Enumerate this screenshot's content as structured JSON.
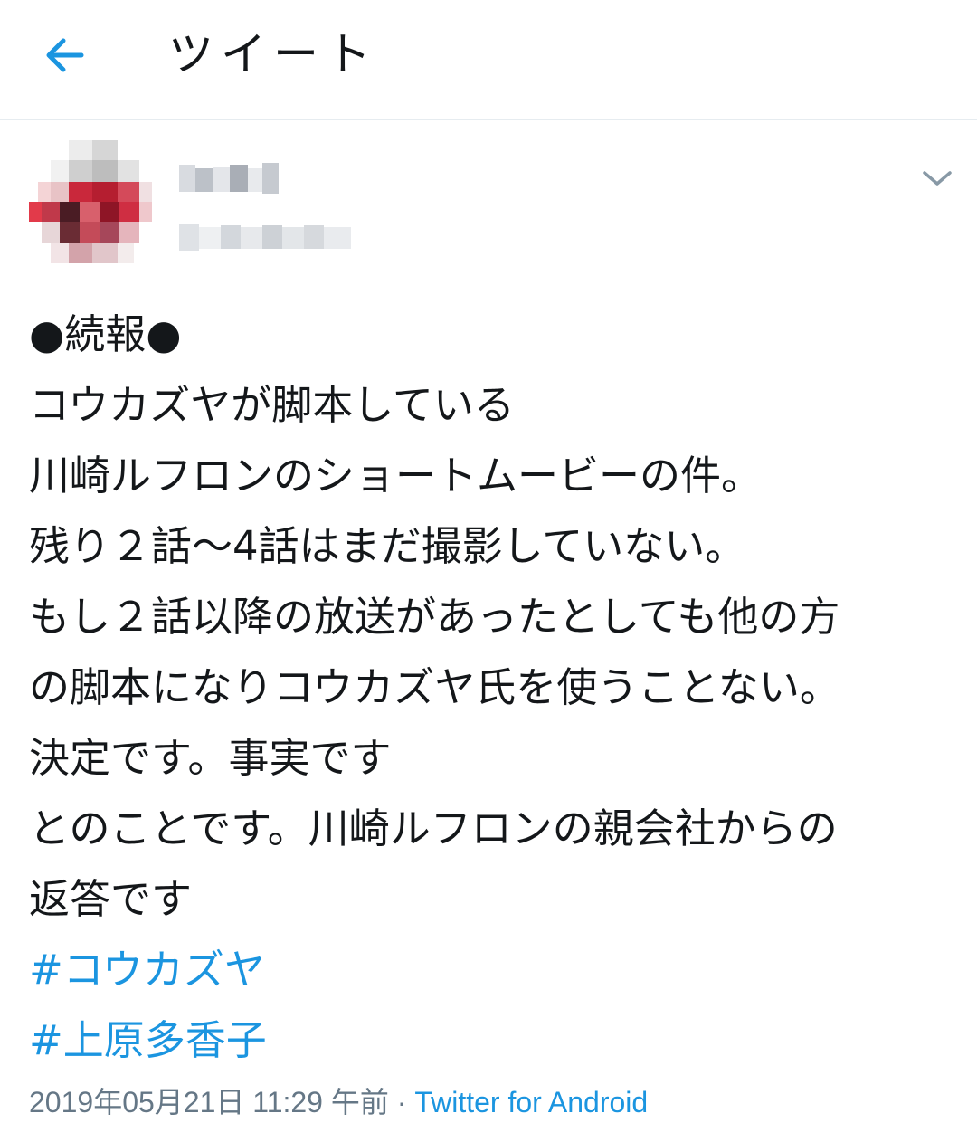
{
  "header": {
    "back_icon": "arrow-left-icon",
    "title": "ツイート"
  },
  "tweet": {
    "avatar": "pixelated-avatar",
    "menu_icon": "chevron-down-icon",
    "lines": [
      "●続報●",
      "コウカズヤが脚本している",
      "川崎ルフロンのショートムービーの件。",
      "残り２話〜4話はまだ撮影していない。",
      "もし２話以降の放送があったとしても他の方",
      "の脚本になりコウカズヤ氏を使うことない。",
      "決定です。事実です",
      "とのことです。川崎ルフロンの親会社からの",
      "返答です"
    ],
    "hashtags": [
      "#コウカズヤ",
      "#上原多香子"
    ],
    "timestamp": "2019年05月21日 11:29 午前",
    "separator": " · ",
    "source": "Twitter for Android"
  },
  "colors": {
    "accent": "#1b95e0",
    "text": "#14171a",
    "muted": "#657786",
    "divider": "#e6ecf0"
  }
}
